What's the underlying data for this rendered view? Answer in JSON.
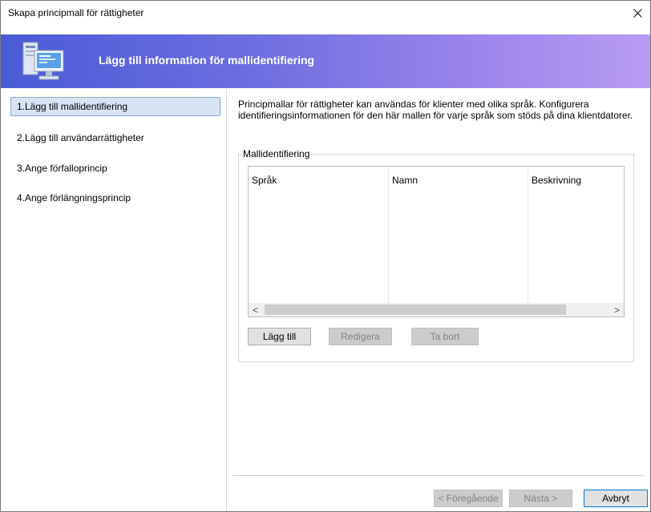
{
  "window": {
    "title": "Skapa principmall för rättigheter",
    "close_glyph": "✕"
  },
  "banner": {
    "title": "Lägg till information för mallidentifiering",
    "icon": "computer-monitor-icon"
  },
  "nav": {
    "items": [
      {
        "label": "1.Lägg till mallidentifiering",
        "active": true
      },
      {
        "label": "2.Lägg till användarrättigheter",
        "active": false
      },
      {
        "label": "3.Ange förfalloprincip",
        "active": false
      },
      {
        "label": "4.Ange förlängningsprincip",
        "active": false
      }
    ]
  },
  "main": {
    "intro_text": "Principmallar för rättigheter kan användas för klienter med olika språk. Konfigurera identifieringsinformationen för den här mallen för varje språk som stöds på dina klientdatorer.",
    "group_label": "Mallidentifiering",
    "columns": [
      "Språk",
      "Namn",
      "Beskrivning"
    ],
    "rows": [],
    "scroll_left": "<",
    "scroll_right": ">",
    "buttons": {
      "add": "Lägg till",
      "edit": "Redigera",
      "remove": "Ta bort"
    }
  },
  "footer": {
    "back": "< Föregående",
    "next": "Nästa >",
    "cancel": "Avbryt"
  },
  "colors": {
    "banner_start": "#4a5bd6",
    "banner_end": "#b89cf2",
    "nav_active_bg": "#d7e4f4",
    "primary_border": "#0078d7"
  }
}
